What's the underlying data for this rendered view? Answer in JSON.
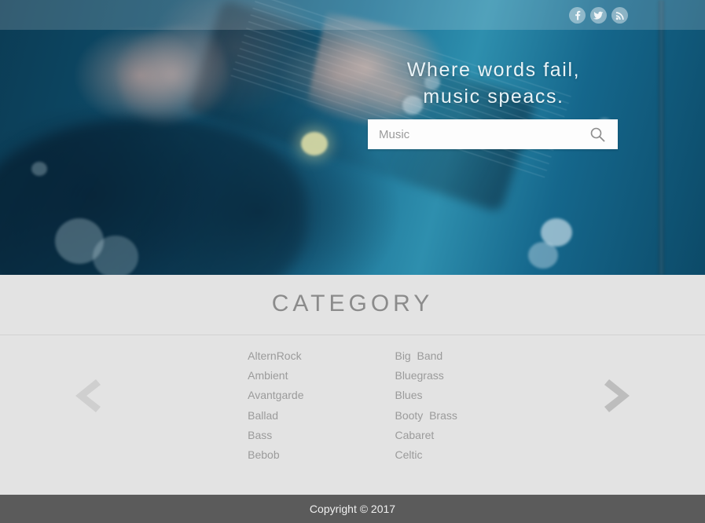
{
  "hero": {
    "tagline": "Where words fail,\nmusic speacs.",
    "search": {
      "value": "",
      "placeholder": "Music",
      "icon": "search-icon"
    },
    "social": [
      {
        "name": "facebook-icon",
        "label": "f"
      },
      {
        "name": "twitter-icon",
        "label": "t"
      },
      {
        "name": "rss-icon",
        "label": "rss"
      }
    ]
  },
  "category": {
    "title": "CATEGORY",
    "prev_arrow": "chevron-left-icon",
    "next_arrow": "chevron-right-icon",
    "columns": [
      {
        "items": [
          "AlternRock",
          "Ambient",
          "Avantgarde",
          "Ballad",
          "Bass",
          "Bebob"
        ]
      },
      {
        "items": [
          "Big  Band",
          "Bluegrass",
          "Blues",
          "Booty  Brass",
          "Cabaret",
          "Celtic"
        ]
      }
    ]
  },
  "footer": {
    "copyright": "Copyright © 2017"
  },
  "colors": {
    "hero_blue": "#0e4e6c",
    "section_bg": "#e3e3e3",
    "footer_bg": "#5b5b5b",
    "text_gray": "#9b9b9b",
    "title_gray": "#8b8b8b"
  }
}
